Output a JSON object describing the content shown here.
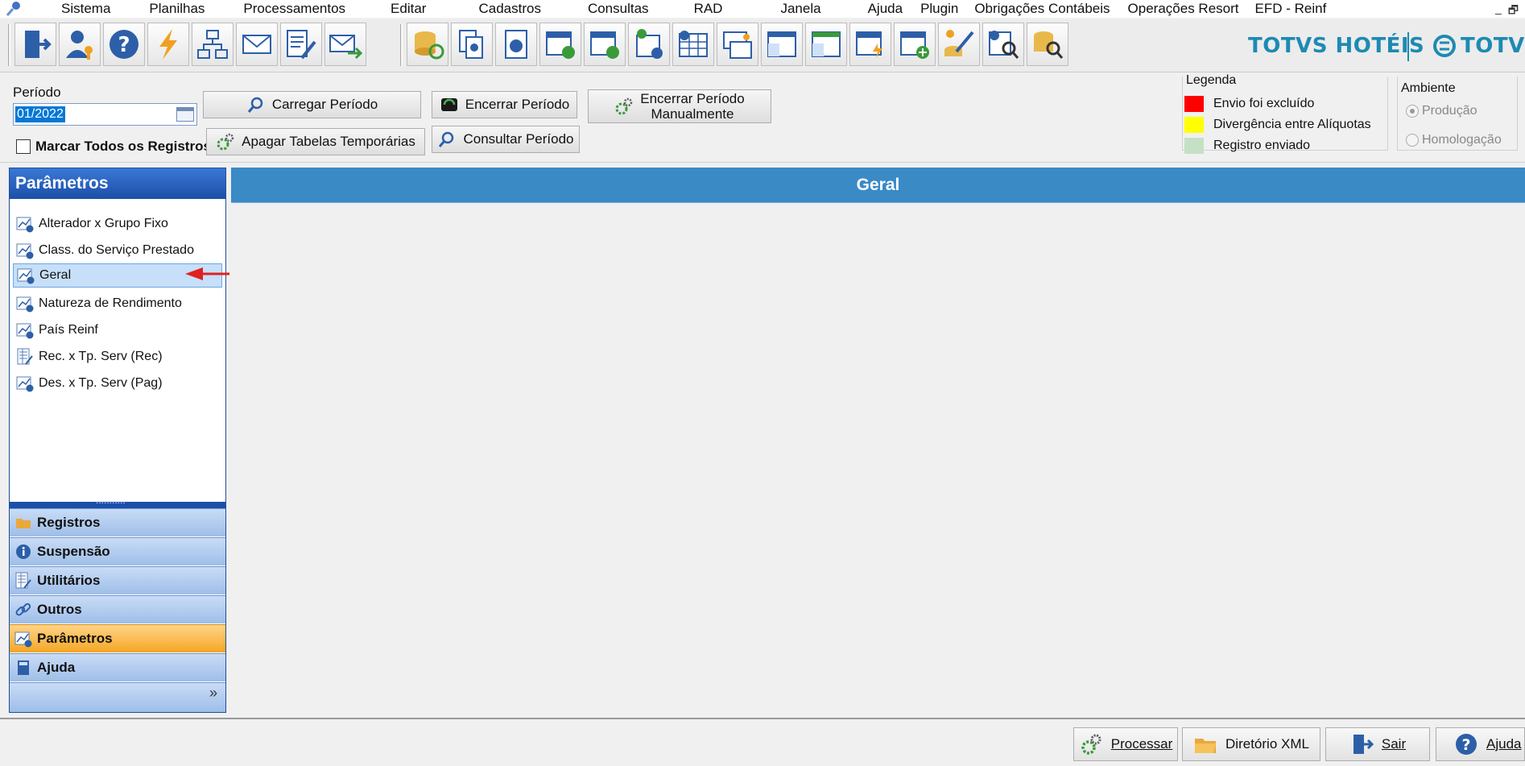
{
  "menu": {
    "items": [
      "Sistema",
      "Planilhas",
      "Processamentos",
      "Editar",
      "Cadastros",
      "Consultas",
      "RAD",
      "Janela",
      "Ajuda",
      "Plugin",
      "Obrigações Contábeis",
      "Operações Resort",
      "EFD - Reinf"
    ],
    "minimize": "_",
    "restore": "🗗"
  },
  "toolbar": {
    "brand_hotels": "TOTVS HOTÉIS",
    "brand_totvs": "TOTVS",
    "brand_color": "#1d8ab3"
  },
  "period": {
    "label": "Período",
    "value": "01/2022",
    "mark_all_label": "Marcar Todos os Registros",
    "load_button": "Carregar Período",
    "close_button": "Encerrar Período",
    "close_manual_line1": "Encerrar Período",
    "close_manual_line2": "Manualmente",
    "delete_temp_button": "Apagar Tabelas Temporárias",
    "consult_button": "Consultar Período"
  },
  "legend": {
    "title": "Legenda",
    "items": [
      {
        "label": "Envio foi excluído",
        "color": "#ff0000"
      },
      {
        "label": "Divergência entre Alíquotas",
        "color": "#ffff00"
      },
      {
        "label": "Registro enviado",
        "color": "#c6e0c6"
      }
    ]
  },
  "ambiente": {
    "title": "Ambiente",
    "options": [
      {
        "label": "Produção",
        "selected": true
      },
      {
        "label": "Homologação",
        "selected": false
      }
    ]
  },
  "sidebar": {
    "header": "Parâmetros",
    "items": [
      {
        "label": "Alterador x Grupo Fixo",
        "icon": "chart-info-icon",
        "selected": false
      },
      {
        "label": "Class. do Serviço Prestado",
        "icon": "chart-info-icon",
        "selected": false
      },
      {
        "label": "Geral",
        "icon": "chart-info-icon",
        "selected": true
      },
      {
        "label": "Natureza de Rendimento",
        "icon": "chart-info-icon",
        "selected": false
      },
      {
        "label": "País Reinf",
        "icon": "chart-info-icon",
        "selected": false
      },
      {
        "label": "Rec. x Tp. Serv (Rec)",
        "icon": "ledger-icon",
        "selected": false
      },
      {
        "label": "Des. x Tp. Serv (Pag)",
        "icon": "chart-info-icon",
        "selected": false
      }
    ],
    "nav": [
      {
        "label": "Registros",
        "icon": "folder-icon",
        "active": false
      },
      {
        "label": "Suspensão",
        "icon": "info-icon",
        "active": false
      },
      {
        "label": "Utilitários",
        "icon": "ledger-icon",
        "active": false
      },
      {
        "label": "Outros",
        "icon": "link-icon",
        "active": false
      },
      {
        "label": "Parâmetros",
        "icon": "chart-info-icon",
        "active": true
      },
      {
        "label": "Ajuda",
        "icon": "book-icon",
        "active": false
      }
    ],
    "footer_chevron": "»"
  },
  "main": {
    "header": "Geral",
    "header_color": "#3a8ac6"
  },
  "bottom": {
    "process_button": "Processar",
    "xml_dir_button": "Diretório XML",
    "exit_button": "Sair",
    "help_button": "Ajuda"
  }
}
